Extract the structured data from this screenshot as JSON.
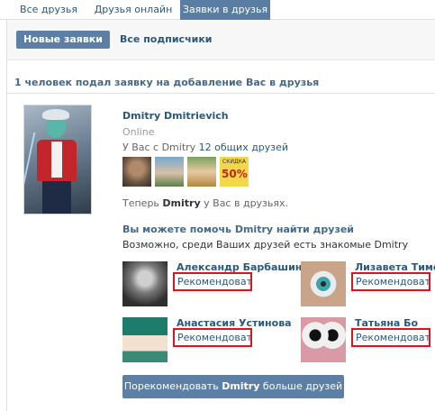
{
  "tabs": [
    {
      "label": "Все друзья"
    },
    {
      "label": "Друзья онлайн"
    },
    {
      "label": "Заявки в друзья"
    }
  ],
  "subtabs": {
    "new_requests": "Новые заявки",
    "all_subscribers": "Все подписчики"
  },
  "requests_header": "1 человек подал заявку на добавление Вас в друзья",
  "request": {
    "name": "Dmitry Dmitrievich",
    "status": "Online",
    "common_prefix": "У Вас с Dmitry",
    "common_link": "12 общих друзей",
    "thumb4_text": "50%",
    "thumb4_small": "СКИДКА",
    "now_friend_prefix": "Теперь",
    "now_friend_name": "Dmitry",
    "now_friend_suffix": "у Вас в друзьях."
  },
  "help": {
    "title": "Вы можете помочь Dmitry найти друзей",
    "subtitle": "Возможно, среди Ваших друзей есть знакомые Dmitry"
  },
  "suggestions": [
    {
      "name": "Александр Барбашин",
      "action": "Рекомендовать"
    },
    {
      "name": "Лизавета Тимоф",
      "action": "Рекомендовать"
    },
    {
      "name": "Анастасия Устинова",
      "action": "Рекомендовать"
    },
    {
      "name": "Татьяна Бо",
      "action": "Рекомендовать"
    }
  ],
  "recommend_more": {
    "prefix": "Порекомендовать",
    "name": "Dmitry",
    "suffix": "больше друзей"
  },
  "colors": {
    "accent": "#597da3",
    "link": "#2b587a",
    "highlight_border": "#e0121e"
  }
}
